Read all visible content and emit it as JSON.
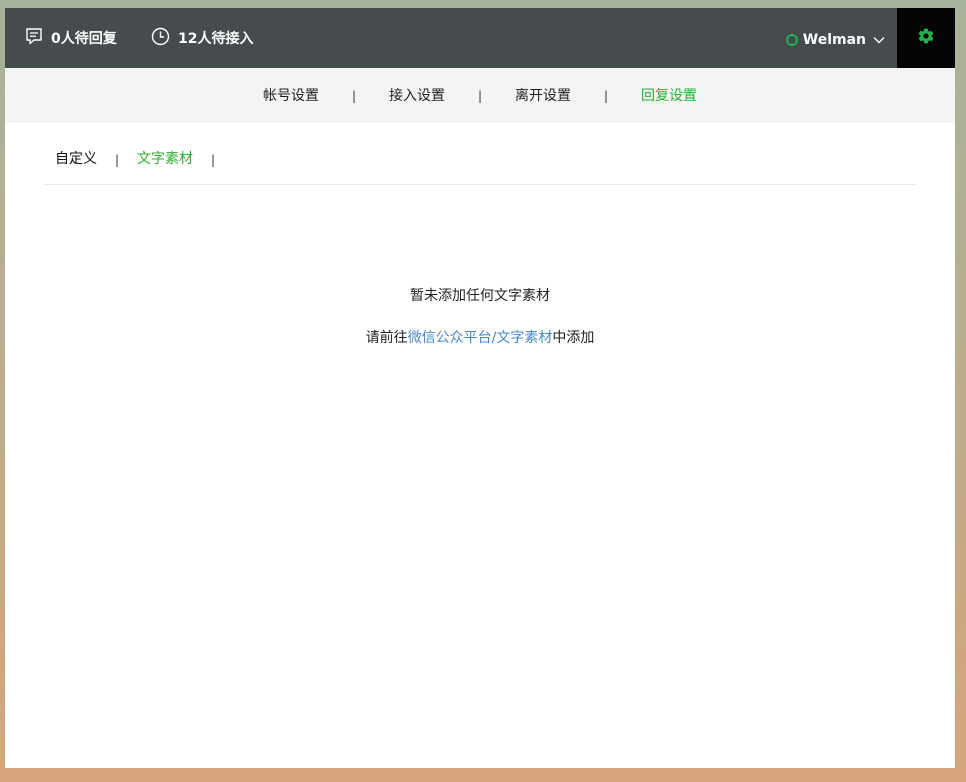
{
  "topbar": {
    "pending_reply": "0人待回复",
    "waiting_queue": "12人待接入",
    "user_name": "Welman",
    "status_color": "#22b14c",
    "settings_color": "#22b14c"
  },
  "main_nav": [
    {
      "label": "帐号设置",
      "active": false
    },
    {
      "label": "接入设置",
      "active": false
    },
    {
      "label": "离开设置",
      "active": false
    },
    {
      "label": "回复设置",
      "active": true
    }
  ],
  "nav_separator": "|",
  "sub_nav": [
    {
      "label": "自定义",
      "active": false
    },
    {
      "label": "文字素材",
      "active": true
    }
  ],
  "empty_state": {
    "title": "暂未添加任何文字素材",
    "hint_prefix": "请前往",
    "hint_link": "微信公众平台/文字素材",
    "hint_suffix": "中添加"
  },
  "colors": {
    "accent": "#2fae2e",
    "link": "#4a88cc",
    "topbar_bg": "#464c4e"
  }
}
